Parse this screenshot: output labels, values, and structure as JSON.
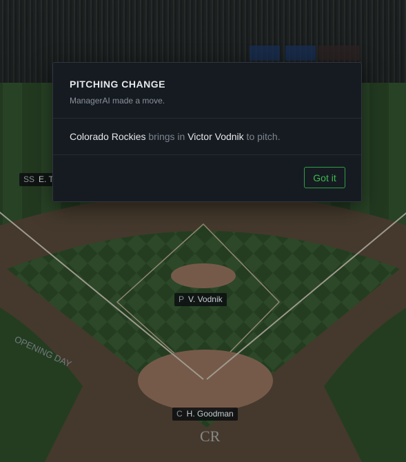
{
  "modal": {
    "title": "PITCHING CHANGE",
    "subtitle": "ManagerAI made a move.",
    "message": {
      "team": "Colorado Rockies",
      "verb": " brings in ",
      "player": "Victor Vodnik",
      "suffix": " to pitch."
    },
    "button_label": "Got it"
  },
  "field_tags": [
    {
      "position": "SS",
      "name": "E. T"
    },
    {
      "position": "P",
      "name": "V. Vodnik"
    },
    {
      "position": "C",
      "name": "H. Goodman"
    }
  ],
  "colors": {
    "accent": "#3fb950",
    "modal_bg": "#161b22",
    "modal_border": "#30363d"
  }
}
